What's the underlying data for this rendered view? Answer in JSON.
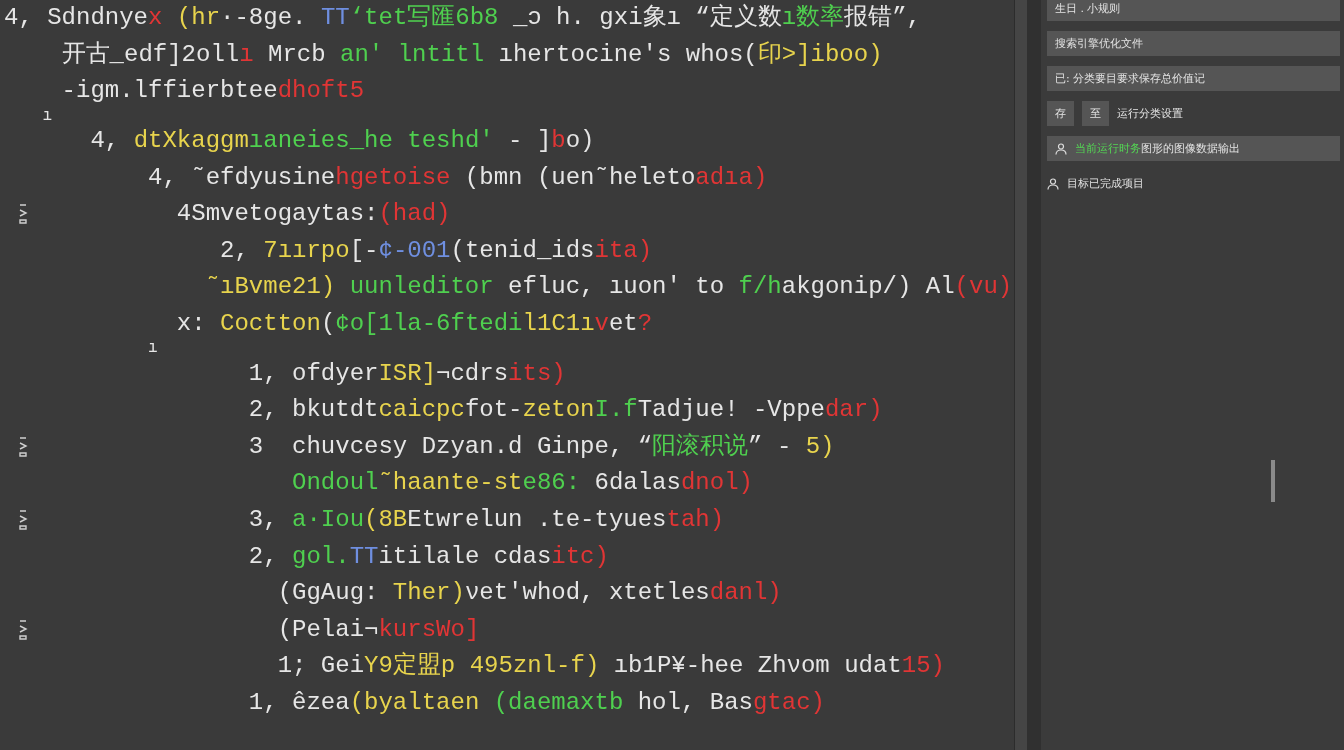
{
  "editor": {
    "lines": [
      {
        "marker": false,
        "segments": [
          {
            "text": "4, Sdndnye",
            "color": "#e6e6e6"
          },
          {
            "text": "x",
            "color": "#e03535"
          },
          {
            "text": " (hr",
            "color": "#e8d44d"
          },
          {
            "text": "·-8ge. ",
            "color": "#e6e6e6"
          },
          {
            "text": "TT",
            "color": "#6f8fe0"
          },
          {
            "text": "‘tet写匯6b8 ",
            "color": "#4fd04f"
          },
          {
            "text": "_ɔ h. gxi象ı “定义数",
            "color": "#e6e6e6"
          },
          {
            "text": "ı数率",
            "color": "#4fd04f"
          },
          {
            "text": "报错”,",
            "color": "#e6e6e6"
          }
        ]
      },
      {
        "marker": false,
        "segments": [
          {
            "text": "    开古_edf]2oll",
            "color": "#e6e6e6"
          },
          {
            "text": "ı",
            "color": "#e03535"
          },
          {
            "text": " Mrcb ",
            "color": "#e6e6e6"
          },
          {
            "text": "an' lntitl",
            "color": "#4fd04f"
          },
          {
            "text": " ıhertocine's whos(",
            "color": "#e6e6e6"
          },
          {
            "text": "印>]",
            "color": "#e8d44d"
          },
          {
            "text": "iboo)",
            "color": "#e8d44d"
          }
        ]
      },
      {
        "marker": false,
        "segments": [
          {
            "text": "    -igm.lffierbtee",
            "color": "#e6e6e6"
          },
          {
            "text": "dhoft5",
            "color": "#e03535"
          }
        ]
      },
      {
        "marker": false,
        "kind": "mark",
        "segments": [
          {
            "text": "    ı",
            "color": "#e6e6e6"
          }
        ]
      },
      {
        "marker": false,
        "segments": [
          {
            "text": "      4, ",
            "color": "#e6e6e6"
          },
          {
            "text": "dtXkaggm",
            "color": "#e8d44d"
          },
          {
            "text": "ıaneies_he teshd'",
            "color": "#4fd04f"
          },
          {
            "text": " - ]",
            "color": "#e6e6e6"
          },
          {
            "text": "b",
            "color": "#e03535"
          },
          {
            "text": "o)",
            "color": "#e6e6e6"
          }
        ]
      },
      {
        "marker": false,
        "segments": [
          {
            "text": "          4, ˜efdyusine",
            "color": "#e6e6e6"
          },
          {
            "text": "hgetoise",
            "color": "#e03535"
          },
          {
            "text": " (bmn (uen˜heleto",
            "color": "#e6e6e6"
          },
          {
            "text": "adıa)",
            "color": "#e03535"
          }
        ]
      },
      {
        "marker": true,
        "segments": [
          {
            "text": "            4Smvetogaytas:",
            "color": "#e6e6e6"
          },
          {
            "text": "(had)",
            "color": "#e03535"
          }
        ]
      },
      {
        "marker": false,
        "segments": [
          {
            "text": "               2, ",
            "color": "#e6e6e6"
          },
          {
            "text": "7ıırpo",
            "color": "#e8d44d"
          },
          {
            "text": "[-",
            "color": "#e6e6e6"
          },
          {
            "text": "¢-001",
            "color": "#6f8fe0"
          },
          {
            "text": "(tenid_ids",
            "color": "#e6e6e6"
          },
          {
            "text": "ita)",
            "color": "#e03535"
          }
        ]
      },
      {
        "marker": false,
        "segments": [
          {
            "text": "              ˜ıBvme21)",
            "color": "#e8d44d"
          },
          {
            "text": " uunleditor",
            "color": "#4fd04f"
          },
          {
            "text": " efluc, ıuon' to ",
            "color": "#e6e6e6"
          },
          {
            "text": "f/h",
            "color": "#4fd04f"
          },
          {
            "text": "akgonip/) Al",
            "color": "#e6e6e6"
          },
          {
            "text": "(vu)",
            "color": "#e03535"
          }
        ]
      },
      {
        "marker": false,
        "segments": [
          {
            "text": "            x: ",
            "color": "#e6e6e6"
          },
          {
            "text": "Coctton",
            "color": "#e8d44d"
          },
          {
            "text": "(",
            "color": "#e6e6e6"
          },
          {
            "text": "¢o[1la-6ftedi",
            "color": "#4fd04f"
          },
          {
            "text": "l1C1ı",
            "color": "#e8d44d"
          },
          {
            "text": "v",
            "color": "#e03535"
          },
          {
            "text": "et",
            "color": "#e6e6e6"
          },
          {
            "text": "?",
            "color": "#e03535"
          }
        ]
      },
      {
        "marker": false,
        "kind": "mark",
        "segments": [
          {
            "text": "               ı",
            "color": "#e6e6e6"
          }
        ]
      },
      {
        "marker": false,
        "segments": [
          {
            "text": "                 1, ofdyer",
            "color": "#e6e6e6"
          },
          {
            "text": "ISR]",
            "color": "#e8d44d"
          },
          {
            "text": "¬cdrs",
            "color": "#e6e6e6"
          },
          {
            "text": "its)",
            "color": "#e03535"
          }
        ]
      },
      {
        "marker": false,
        "segments": [
          {
            "text": "                 2, bkutdt",
            "color": "#e6e6e6"
          },
          {
            "text": "caicpc",
            "color": "#e8d44d"
          },
          {
            "text": "fot-",
            "color": "#e6e6e6"
          },
          {
            "text": "zeton",
            "color": "#e8d44d"
          },
          {
            "text": "I.f",
            "color": "#4fd04f"
          },
          {
            "text": "Tadjue! -Vppe",
            "color": "#e6e6e6"
          },
          {
            "text": "dar)",
            "color": "#e03535"
          }
        ]
      },
      {
        "marker": true,
        "segments": [
          {
            "text": "                 3  chuvcesy Dzyan.d Ginpe, “",
            "color": "#e6e6e6"
          },
          {
            "text": "阳滚积说",
            "color": "#4fd04f"
          },
          {
            "text": "” - ",
            "color": "#e6e6e6"
          },
          {
            "text": "5)",
            "color": "#e8d44d"
          }
        ]
      },
      {
        "marker": false,
        "segments": [
          {
            "text": "                    Ondoul",
            "color": "#4fd04f"
          },
          {
            "text": "˜haante-st",
            "color": "#e8d44d"
          },
          {
            "text": "e86:",
            "color": "#4fd04f"
          },
          {
            "text": " 6dalas",
            "color": "#e6e6e6"
          },
          {
            "text": "dnol)",
            "color": "#e03535"
          }
        ]
      },
      {
        "marker": true,
        "segments": [
          {
            "text": "                 3, ",
            "color": "#e6e6e6"
          },
          {
            "text": "a·Iou",
            "color": "#4fd04f"
          },
          {
            "text": "(8B",
            "color": "#e8d44d"
          },
          {
            "text": "Etwrelun .te-tyues",
            "color": "#e6e6e6"
          },
          {
            "text": "tah)",
            "color": "#e03535"
          }
        ]
      },
      {
        "marker": false,
        "segments": [
          {
            "text": "                 2, ",
            "color": "#e6e6e6"
          },
          {
            "text": "gol.",
            "color": "#4fd04f"
          },
          {
            "text": "TT",
            "color": "#6f8fe0"
          },
          {
            "text": "itilale cdas",
            "color": "#e6e6e6"
          },
          {
            "text": "itc)",
            "color": "#e03535"
          }
        ]
      },
      {
        "marker": false,
        "segments": [
          {
            "text": "                   (GgAug:",
            "color": "#e6e6e6"
          },
          {
            "text": " Ther)",
            "color": "#e8d44d"
          },
          {
            "text": "νet'whod, xtetles",
            "color": "#e6e6e6"
          },
          {
            "text": "danl)",
            "color": "#e03535"
          }
        ]
      },
      {
        "marker": true,
        "segments": [
          {
            "text": "                   (Pelai¬",
            "color": "#e6e6e6"
          },
          {
            "text": "kursWo]",
            "color": "#e03535"
          }
        ]
      },
      {
        "marker": false,
        "segments": [
          {
            "text": "                   1; Gei",
            "color": "#e6e6e6"
          },
          {
            "text": "Y9定盟p 495",
            "color": "#e8d44d"
          },
          {
            "text": "znl-f)",
            "color": "#e8d44d"
          },
          {
            "text": " ıb1P¥-hee Zhνom udat",
            "color": "#e6e6e6"
          },
          {
            "text": "15)",
            "color": "#e03535"
          }
        ]
      },
      {
        "marker": false,
        "segments": [
          {
            "text": "                 1, êzea",
            "color": "#e6e6e6"
          },
          {
            "text": "(byaltaen",
            "color": "#e8d44d"
          },
          {
            "text": " (daemaxtb",
            "color": "#4fd04f"
          },
          {
            "text": " hol, Bas",
            "color": "#e6e6e6"
          },
          {
            "text": "gtac)",
            "color": "#e03535"
          }
        ]
      }
    ]
  },
  "panel": {
    "rows": [
      {
        "kind": "field",
        "tags": [],
        "icon": false,
        "accent": "",
        "text": "生日 . 小规则"
      },
      {
        "kind": "field",
        "tags": [],
        "icon": false,
        "accent": "",
        "text": "搜索引擎优化文件"
      },
      {
        "kind": "field",
        "tags": [],
        "icon": false,
        "accent": "",
        "text": "已: 分类要目要求保存总价值记"
      },
      {
        "kind": "plain",
        "tags": [
          "存",
          "至"
        ],
        "icon": false,
        "accent": "",
        "text": "运行分类设置"
      },
      {
        "kind": "field",
        "tags": [],
        "icon": true,
        "accent": "当前运行时务",
        "text": "图形的图像数据输出"
      },
      {
        "kind": "plain",
        "tags": [],
        "icon": true,
        "accent": "",
        "text": "目标已完成项目"
      }
    ]
  }
}
